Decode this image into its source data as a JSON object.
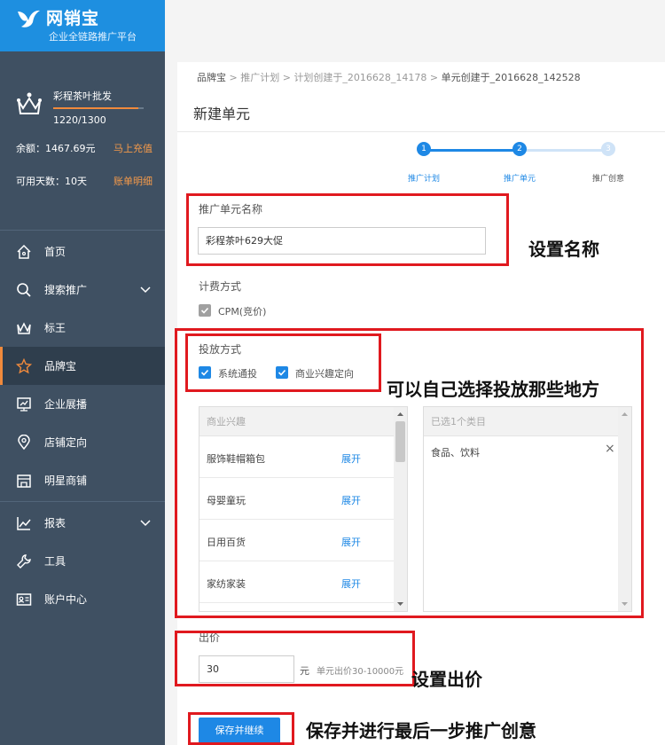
{
  "logo": {
    "title": "网销宝",
    "subtitle": "企业全链路推广平台"
  },
  "account": {
    "shop_name": "彩程茶叶批发",
    "progress_text": "1220/1300",
    "progress_fraction": 0.938,
    "balance": "余额：1467.69元",
    "recharge_link": "马上充值",
    "days": "可用天数：10天",
    "bill_link": "账单明细"
  },
  "nav": [
    {
      "label": "首页",
      "icon": "home-icon"
    },
    {
      "label": "搜索推广",
      "icon": "search-icon",
      "expand": true
    },
    {
      "label": "标王",
      "icon": "crown-icon"
    },
    {
      "label": "品牌宝",
      "icon": "star-icon",
      "active": true
    },
    {
      "label": "企业展播",
      "icon": "display-icon"
    },
    {
      "label": "店铺定向",
      "icon": "location-icon"
    },
    {
      "label": "明星商铺",
      "icon": "store-icon"
    },
    {
      "label": "报表",
      "icon": "chart-icon",
      "expand": true
    },
    {
      "label": "工具",
      "icon": "wrench-icon"
    },
    {
      "label": "账户中心",
      "icon": "id-card-icon"
    }
  ],
  "breadcrumb": [
    "品牌宝",
    "推广计划",
    "计划创建于_2016628_14178",
    "单元创建于_2016628_142528"
  ],
  "page_title": "新建单元",
  "steps": [
    {
      "num": "1",
      "label": "推广计划"
    },
    {
      "num": "2",
      "label": "推广单元"
    },
    {
      "num": "3",
      "label": "推广创意"
    }
  ],
  "unit_name": {
    "label": "推广单元名称",
    "value": "彩程茶叶629大促"
  },
  "billing": {
    "label": "计费方式",
    "option": "CPM(竞价)"
  },
  "delivery": {
    "label": "投放方式",
    "options": [
      "系统通投",
      "商业兴趣定向"
    ]
  },
  "interests": {
    "header": "商业兴趣",
    "expand_label": "展开",
    "items": [
      "服饰鞋帽箱包",
      "母婴童玩",
      "日用百货",
      "家纺家装"
    ]
  },
  "selected": {
    "header": "已选1个类目",
    "items": [
      "食品、饮料"
    ],
    "remove": "×"
  },
  "bid": {
    "label": "出价",
    "value": "30",
    "unit": "元",
    "hint": "单元出价30-10000元"
  },
  "save_button": "保存并继续",
  "annotations": {
    "name": "设置名称",
    "delivery": "可以自己选择投放那些地方",
    "bid": "设置出价",
    "save": "保存并进行最后一步推广创意"
  },
  "colors": {
    "sidebar": "#3f5062",
    "brand": "#1e8fe0",
    "accent": "#f08a3c",
    "red_box": "#e0191f"
  }
}
